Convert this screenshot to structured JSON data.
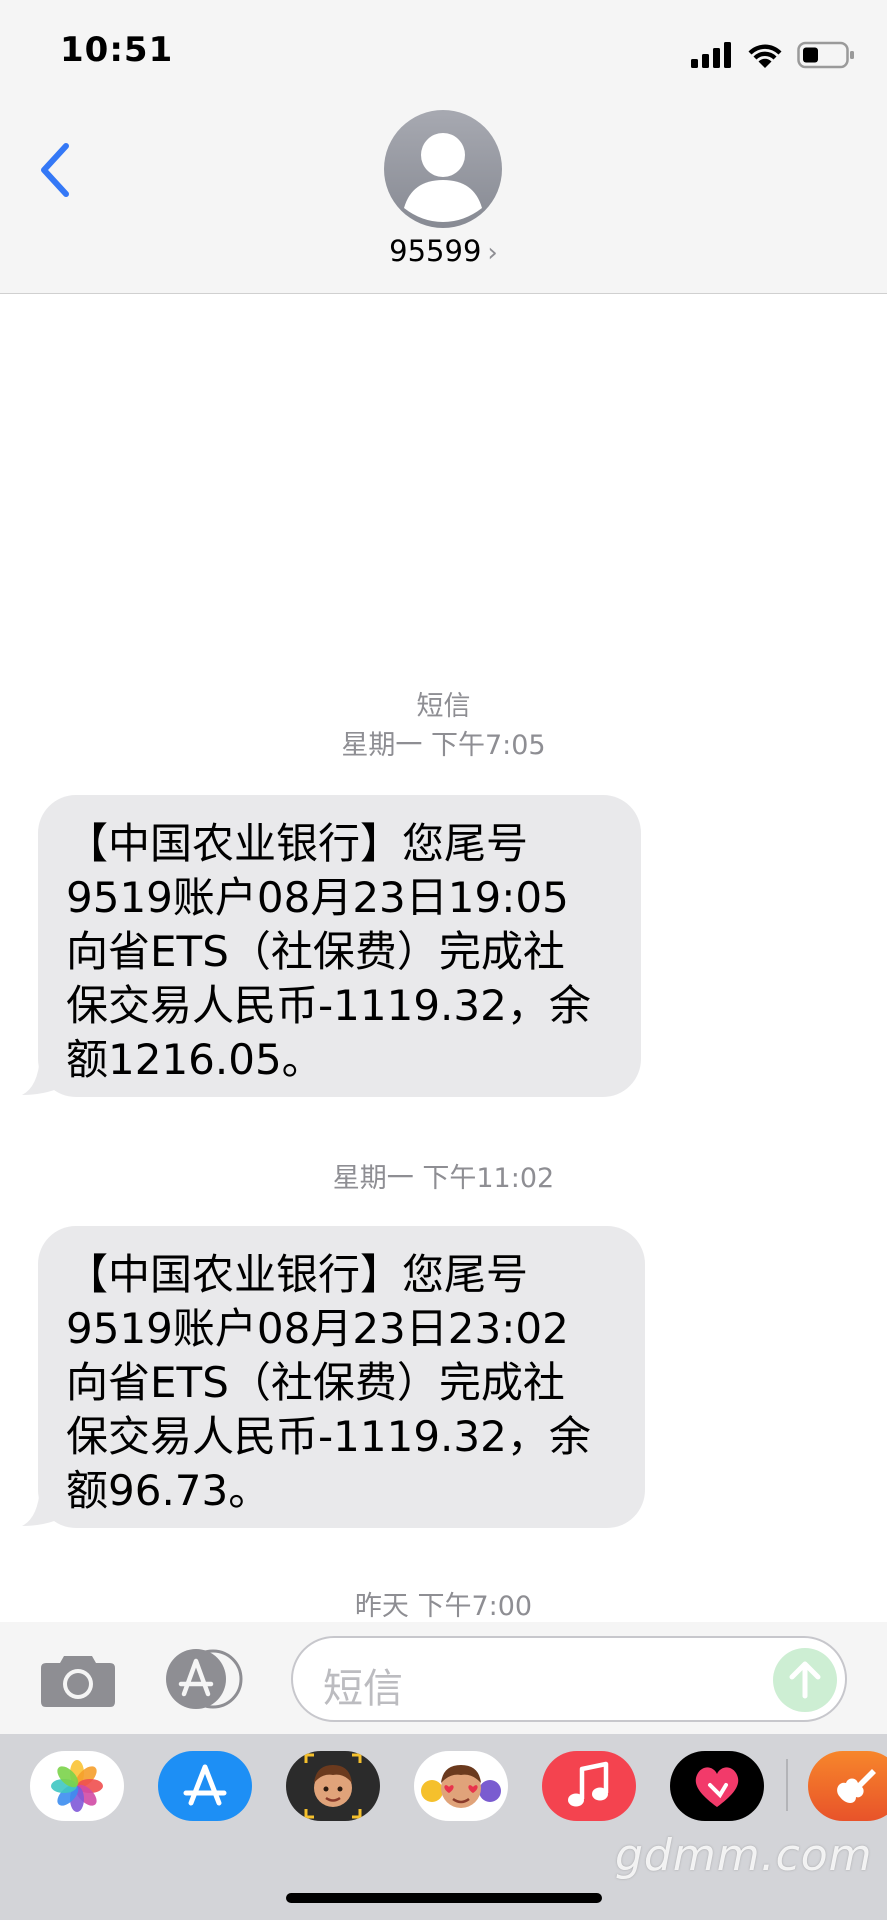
{
  "status_bar": {
    "time": "10:51"
  },
  "header": {
    "contact_name": "95599",
    "chevron": "›"
  },
  "conversation": {
    "service_label": "短信",
    "messages": [
      {
        "timestamp": "星期一 下午7:05",
        "lines": [
          "【中国农业银行】您尾号",
          "9519账户08月23日19:05",
          "向省ETS（社保费）完成社",
          "保交易人民币-1119.32，余",
          "额1216.05。"
        ]
      },
      {
        "timestamp": "星期一 下午11:02",
        "lines": [
          "【中国农业银行】您尾号",
          "9519账户08月23日23:02",
          "向省ETS（社保费）完成社",
          "保交易人民币-1119.32，余",
          "额96.73。"
        ]
      }
    ],
    "trailing_timestamp": "昨天 下午7:00"
  },
  "input_bar": {
    "placeholder": "短信"
  },
  "app_drawer": {
    "apps": [
      "photos-icon",
      "app-store-icon",
      "memoji-icon",
      "animoji-icon",
      "music-icon",
      "digital-touch-icon",
      "garageband-icon"
    ]
  },
  "watermark": "gdmm.com",
  "colors": {
    "accent": "#3478f6",
    "bubble": "#e9e9eb",
    "meta_text": "#8e8e93",
    "send_button": "#cdeed3"
  }
}
